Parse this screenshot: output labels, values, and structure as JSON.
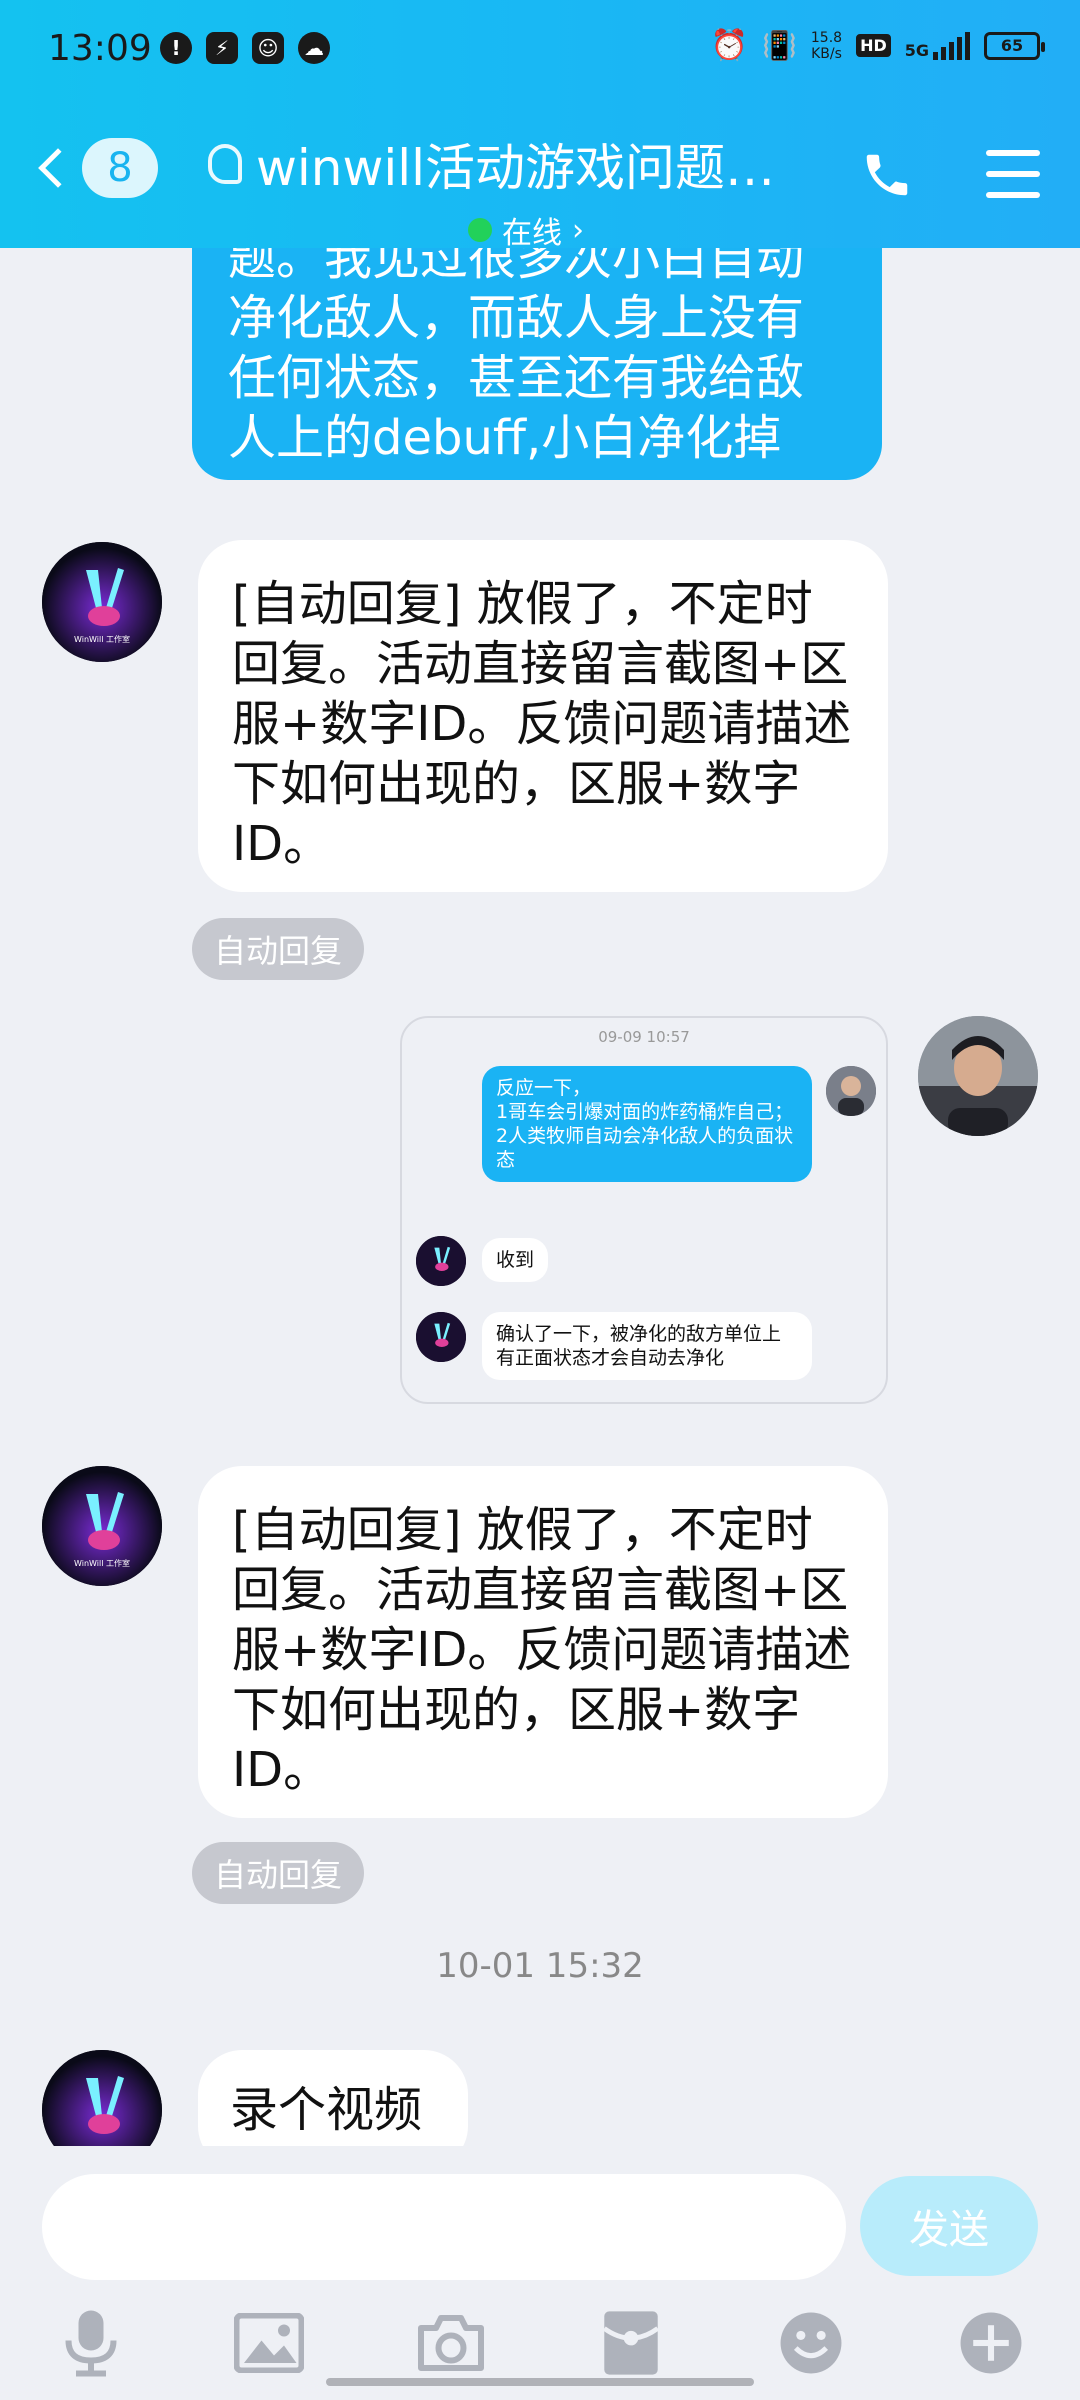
{
  "status_bar": {
    "time": "13:09",
    "speed": "15.8",
    "speed_unit": "KB/s",
    "hd": "HD",
    "network": "5G",
    "battery": "65"
  },
  "header": {
    "unread_count": "8",
    "title": "winwill活动游戏问题…",
    "status": "在线",
    "status_arrow": "›"
  },
  "messages": {
    "m1_text": "题。我见过很多次小白自动净化敌人，而敌人身上没有任何状态，甚至还有我给敌人上的debuff,小白净化掉",
    "m2_text": "[自动回复] 放假了，不定时回复。活动直接留言截图+区服+数字ID。反馈问题请描述下如何出现的，区服+数字ID。",
    "m2_tag": "自动回复",
    "m3_text": "[自动回复] 放假了，不定时回复。活动直接留言截图+区服+数字ID。反馈问题请描述下如何出现的，区服+数字ID。",
    "m3_tag": "自动回复",
    "timestamp": "10-01 15:32",
    "m4_text": "录个视频"
  },
  "forward_card": {
    "time": "09-09 10:57",
    "msg1": "反应一下，\n1哥车会引爆对面的炸药桶炸自己；\n2人类牧师自动会净化敌人的负面状态",
    "msg2": "收到",
    "msg3": "确认了一下，被净化的敌方单位上有正面状态才会自动去净化"
  },
  "input": {
    "send_label": "发送"
  },
  "avatar_label": "WinWill 工作室",
  "colors": {
    "header": "#19b8f4",
    "bubble_blue": "#1ab3f4",
    "online": "#22d15a"
  }
}
